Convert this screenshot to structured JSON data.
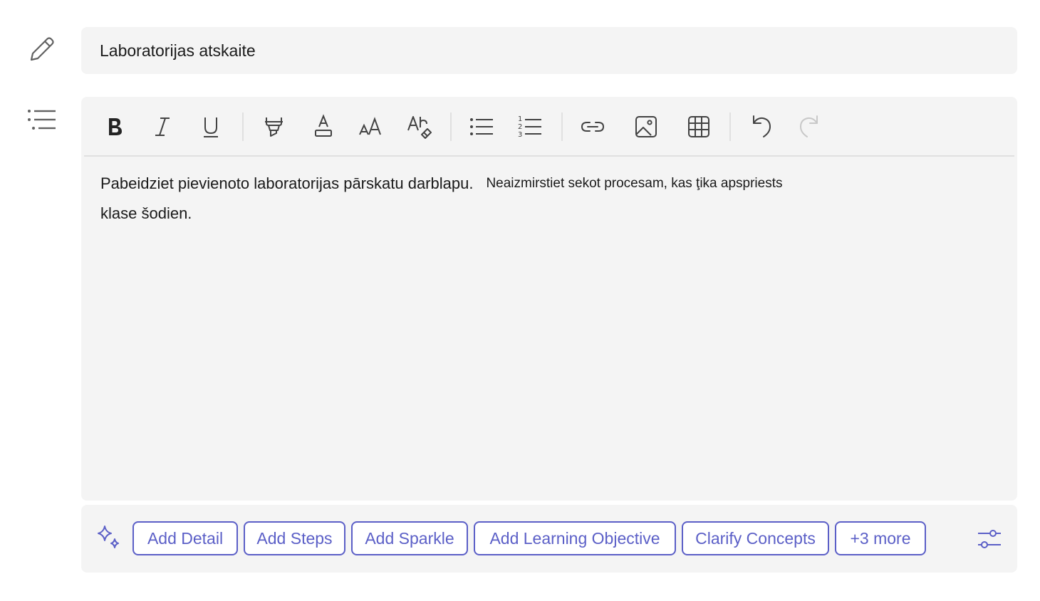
{
  "title": {
    "value": "Laboratorijas atskaite"
  },
  "toolbar": {
    "buttons": [
      {
        "name": "bold-button",
        "icon": "bold-icon"
      },
      {
        "name": "italic-button",
        "icon": "italic-icon"
      },
      {
        "name": "underline-button",
        "icon": "underline-icon"
      },
      {
        "name": "highlight-button",
        "icon": "highlighter-icon"
      },
      {
        "name": "font-color-button",
        "icon": "font-color-icon"
      },
      {
        "name": "font-size-button",
        "icon": "font-size-icon"
      },
      {
        "name": "clear-formatting-button",
        "icon": "clear-formatting-icon"
      },
      {
        "name": "bulleted-list-button",
        "icon": "bulleted-list-icon"
      },
      {
        "name": "numbered-list-button",
        "icon": "numbered-list-icon"
      },
      {
        "name": "insert-link-button",
        "icon": "link-icon"
      },
      {
        "name": "insert-image-button",
        "icon": "image-icon"
      },
      {
        "name": "insert-table-button",
        "icon": "table-icon"
      },
      {
        "name": "undo-button",
        "icon": "undo-icon"
      },
      {
        "name": "redo-button",
        "icon": "redo-icon"
      }
    ]
  },
  "content": {
    "line1_main": "Pabeidziet pievienoto laboratorijas pārskatu darblapu.",
    "line1_small": "Neaizmirstiet sekot procesam, kas ţika apspriests",
    "line2": "klase šodien."
  },
  "ai_suggestions": {
    "icon": "sparkle-icon",
    "chips": [
      "Add Detail",
      "Add Steps",
      "Add Sparkle",
      "Add Learning Objective",
      "Clarify Concepts",
      "+3 more"
    ],
    "settings_icon": "settings-sliders-icon"
  },
  "colors": {
    "accent": "#5b5fc7",
    "field_background": "#f4f4f4",
    "icon_color": "#424242",
    "disabled_icon": "#c8c8c8"
  }
}
